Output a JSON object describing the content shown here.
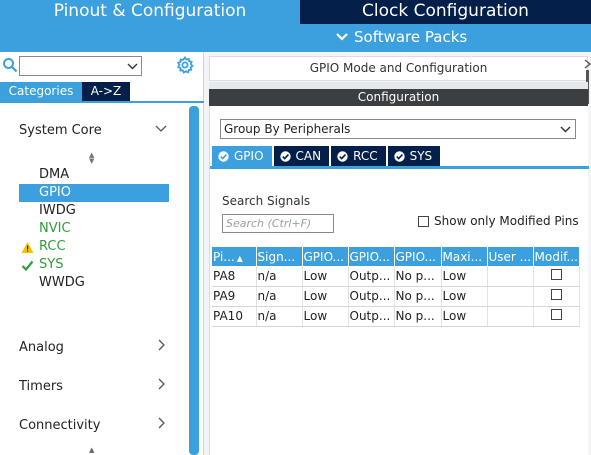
{
  "header": {
    "tab_pinout": "Pinout & Configuration",
    "tab_clock": "Clock Configuration",
    "software_packs": "Software Packs"
  },
  "left": {
    "search_placeholder": "",
    "seg_categories": "Categories",
    "seg_az": "A->Z",
    "system_core": "System Core",
    "items": [
      {
        "label": "DMA",
        "status": "none"
      },
      {
        "label": "GPIO",
        "status": "selected"
      },
      {
        "label": "IWDG",
        "status": "none"
      },
      {
        "label": "NVIC",
        "status": "green"
      },
      {
        "label": "RCC",
        "status": "warning"
      },
      {
        "label": "SYS",
        "status": "ok"
      },
      {
        "label": "WWDG",
        "status": "none"
      }
    ],
    "analog": "Analog",
    "timers": "Timers",
    "connectivity": "Connectivity"
  },
  "right": {
    "title": "GPIO Mode and Configuration",
    "config_header": "Configuration",
    "group_by": "Group By Peripherals",
    "tabs": [
      "GPIO",
      "CAN",
      "RCC",
      "SYS"
    ],
    "search_label": "Search Signals",
    "search_placeholder": "Search (Ctrl+F)",
    "show_modified": "Show only Modified Pins",
    "table": {
      "headers": [
        "Pi...",
        "Sign...",
        "GPIO...",
        "GPIO...",
        "GPIO...",
        "Maxi...",
        "User ...",
        "Modif..."
      ],
      "rows": [
        [
          "PA8",
          "n/a",
          "Low",
          "Outp...",
          "No p...",
          "Low",
          "",
          ""
        ],
        [
          "PA9",
          "n/a",
          "Low",
          "Outp...",
          "No p...",
          "Low",
          "",
          ""
        ],
        [
          "PA10",
          "n/a",
          "Low",
          "Outp...",
          "No p...",
          "Low",
          "",
          ""
        ]
      ]
    }
  },
  "colors": {
    "accent": "#3ba0dd",
    "dark_navy": "#04204a",
    "config_bar": "#3c3f42",
    "ok_green": "#2e9e3a",
    "warning": "#f2c200"
  }
}
